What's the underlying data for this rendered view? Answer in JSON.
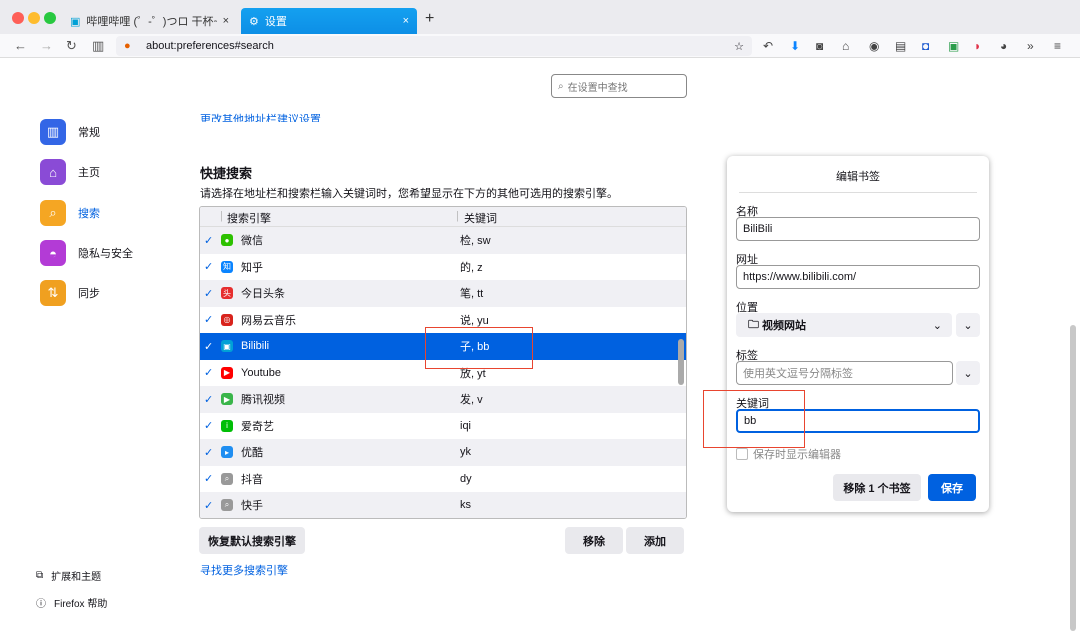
{
  "tabs": [
    {
      "label": "哔哩哔哩 (゜-゜)つロ 干杯~-bilibili"
    },
    {
      "label": "设置"
    }
  ],
  "address": "about:preferences#search",
  "settings_search_placeholder": "在设置中查找",
  "sidebar": {
    "items": [
      {
        "label": "常规",
        "color": "#3366e6"
      },
      {
        "label": "主页",
        "color": "#8a4bd6"
      },
      {
        "label": "搜索",
        "color": "#f5a623"
      },
      {
        "label": "隐私与安全",
        "color": "#b33bd6"
      },
      {
        "label": "同步",
        "color": "#f0a020"
      }
    ],
    "extensions": "扩展和主题",
    "help": "Firefox 帮助"
  },
  "top_link": "更改其他地址栏建议设置",
  "section": {
    "title": "快捷搜索",
    "description": "请选择在地址栏和搜索栏输入关键词时，您希望显示在下方的其他可选用的搜索引擎。"
  },
  "table": {
    "headers": [
      "搜索引擎",
      "关键词"
    ],
    "rows": [
      {
        "name": "微信",
        "keyword": "检, sw",
        "color": "#2dc100",
        "glyph": "●"
      },
      {
        "name": "知乎",
        "keyword": "的, z",
        "color": "#0a84ff",
        "glyph": "知"
      },
      {
        "name": "今日头条",
        "keyword": "笔, tt",
        "color": "#e62e2e",
        "glyph": "头"
      },
      {
        "name": "网易云音乐",
        "keyword": "说, yu",
        "color": "#d8231c",
        "glyph": "◎"
      },
      {
        "name": "Bilibili",
        "keyword": "子, bb",
        "color": "#00a1d6",
        "glyph": "▣"
      },
      {
        "name": "Youtube",
        "keyword": "放, yt",
        "color": "#ff0000",
        "glyph": "▶"
      },
      {
        "name": "腾讯视频",
        "keyword": "发, v",
        "color": "#3ab54a",
        "glyph": "▶"
      },
      {
        "name": "爱奇艺",
        "keyword": "iqi",
        "color": "#00be06",
        "glyph": "i"
      },
      {
        "name": "优酷",
        "keyword": "yk",
        "color": "#1f8ef1",
        "glyph": "▸"
      },
      {
        "name": "抖音",
        "keyword": "dy",
        "color": "#999999",
        "glyph": "⌕"
      },
      {
        "name": "快手",
        "keyword": "ks",
        "color": "#999999",
        "glyph": "⌕"
      }
    ],
    "selected": 4
  },
  "buttons": {
    "restore": "恢复默认搜索引擎",
    "remove": "移除",
    "add": "添加"
  },
  "find_more": "寻找更多搜索引擎",
  "bookmark": {
    "title": "编辑书签",
    "name_label": "名称",
    "name": "BiliBili",
    "url_label": "网址",
    "url": "https://www.bilibili.com/",
    "location_label": "位置",
    "location": "视频网站",
    "tags_label": "标签",
    "tags_placeholder": "使用英文逗号分隔标签",
    "keyword_label": "关键词",
    "keyword": "bb",
    "show_editor": "保存时显示编辑器",
    "remove": "移除 1 个书签",
    "save": "保存"
  }
}
